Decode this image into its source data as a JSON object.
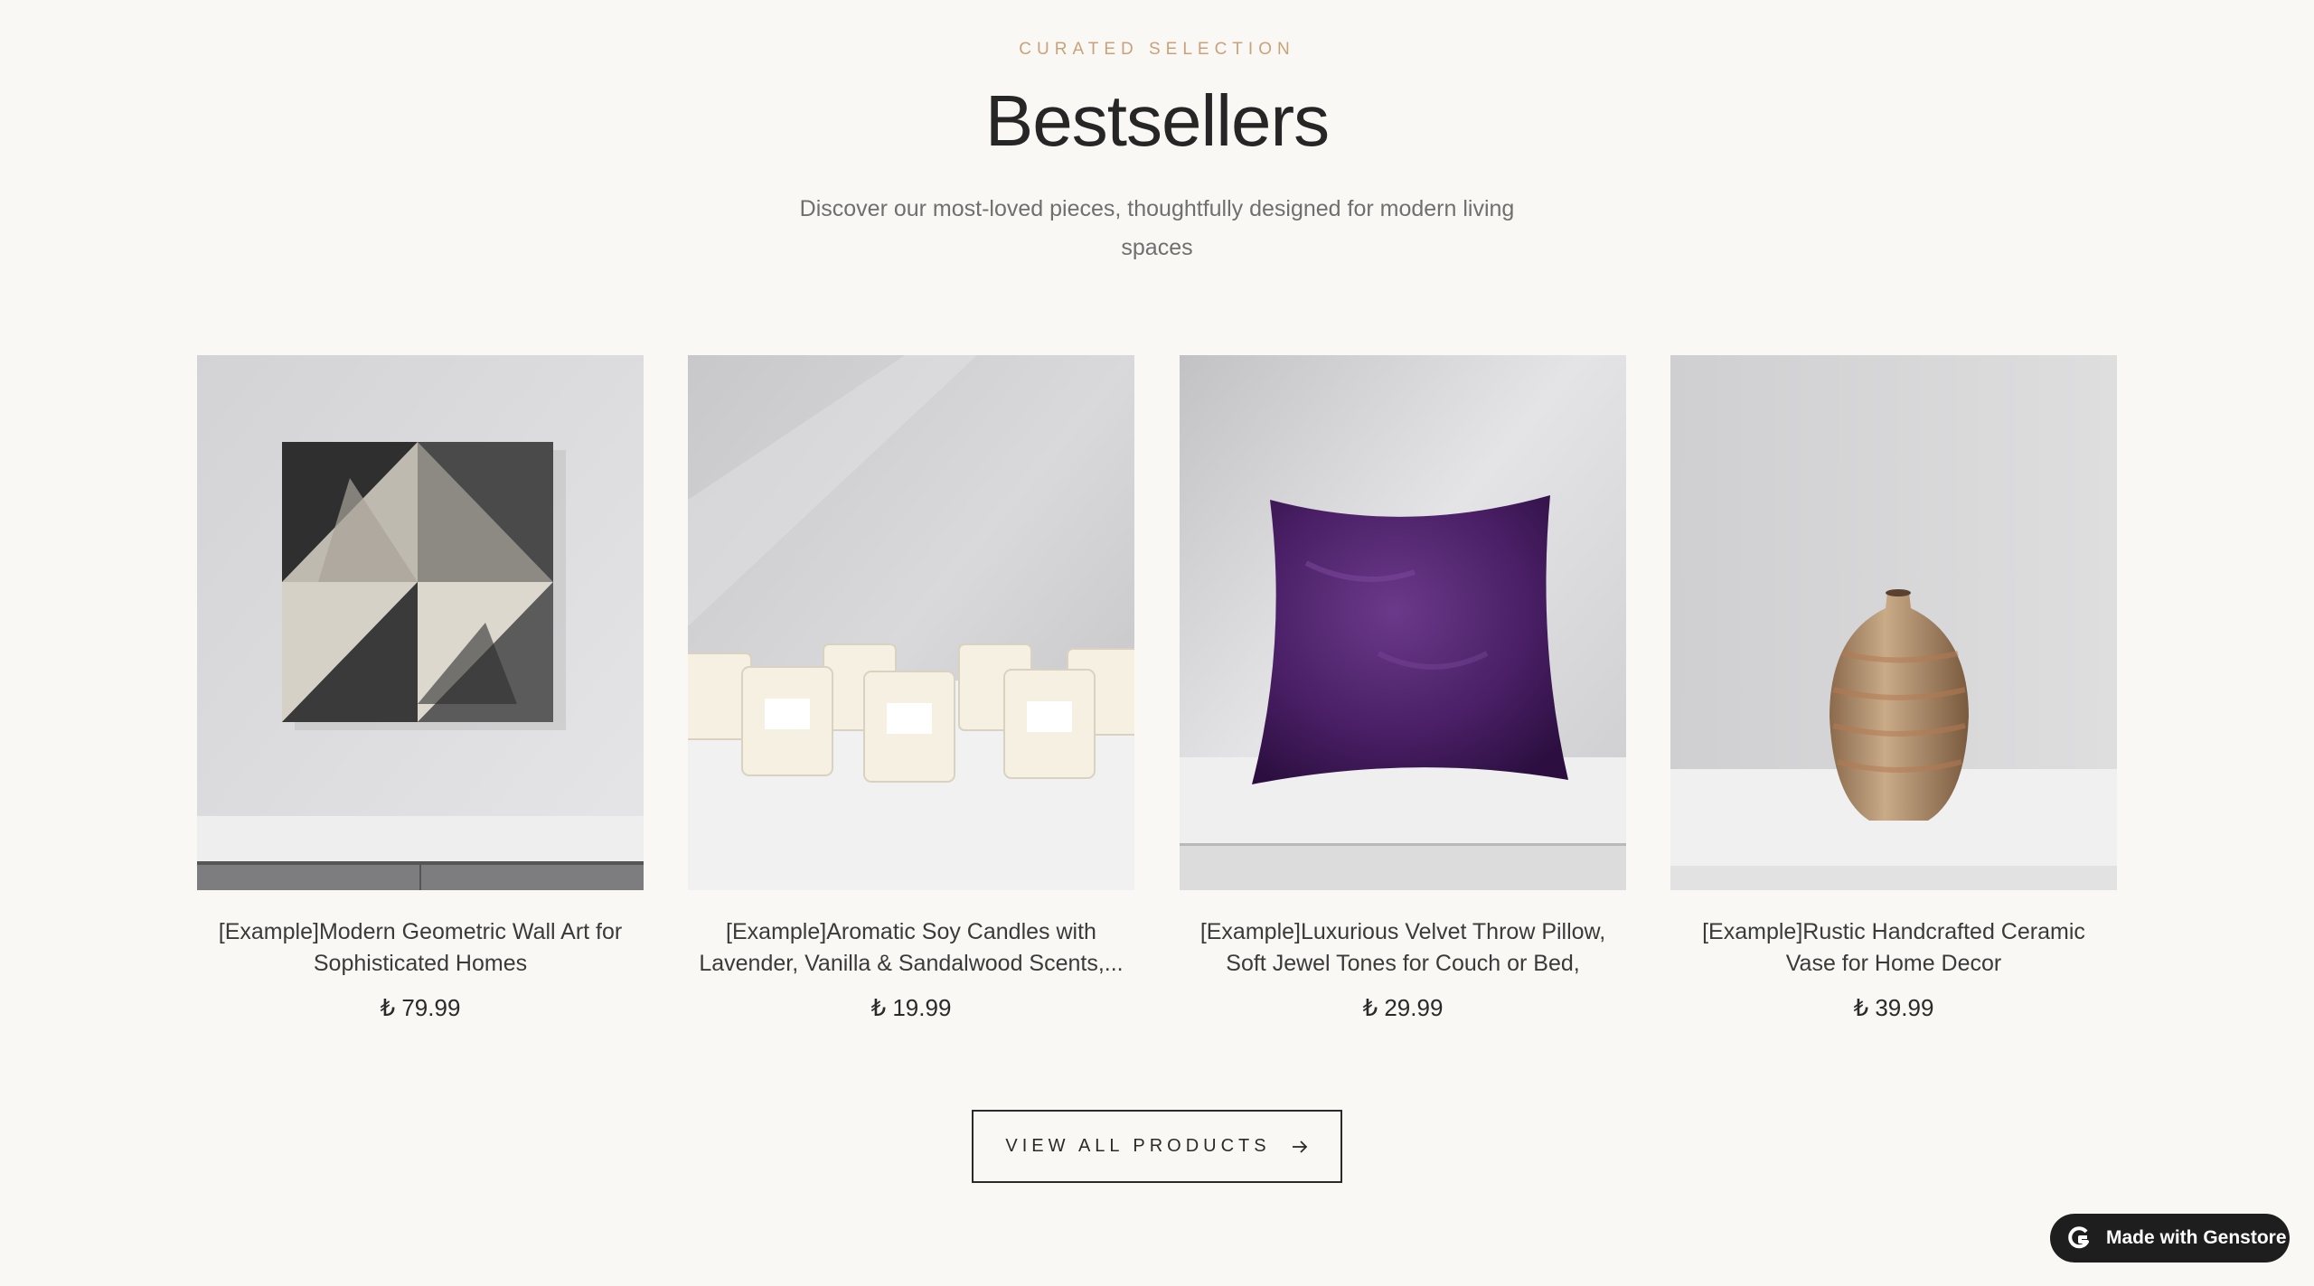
{
  "section": {
    "eyebrow": "CURATED SELECTION",
    "title": "Bestsellers",
    "subtitle": "Discover our most-loved pieces, thoughtfully designed for modern living spaces"
  },
  "products": [
    {
      "name": "[Example]Modern Geometric Wall Art for Sophisticated Homes",
      "price": "₺ 79.99",
      "image": "geometric-wall-art-image"
    },
    {
      "name": "[Example]Aromatic Soy Candles with Lavender, Vanilla & Sandalwood Scents,...",
      "price": "₺ 19.99",
      "image": "soy-candles-image"
    },
    {
      "name": "[Example]Luxurious Velvet Throw Pillow, Soft Jewel Tones for Couch or Bed, Stylish..",
      "price": "₺ 29.99",
      "image": "velvet-pillow-image"
    },
    {
      "name": "[Example]Rustic Handcrafted Ceramic Vase for Home Decor",
      "price": "₺ 39.99",
      "image": "ceramic-vase-image"
    }
  ],
  "cta": {
    "label": "VIEW ALL PRODUCTS",
    "icon": "arrow-right-icon"
  },
  "badge": {
    "label": "Made with Genstore",
    "icon": "genstore-logo-icon"
  },
  "colors": {
    "background": "#f9f8f4",
    "accent": "#c9a27a",
    "text": "#2a2a2a",
    "badge_bg": "#1e1e1e"
  }
}
